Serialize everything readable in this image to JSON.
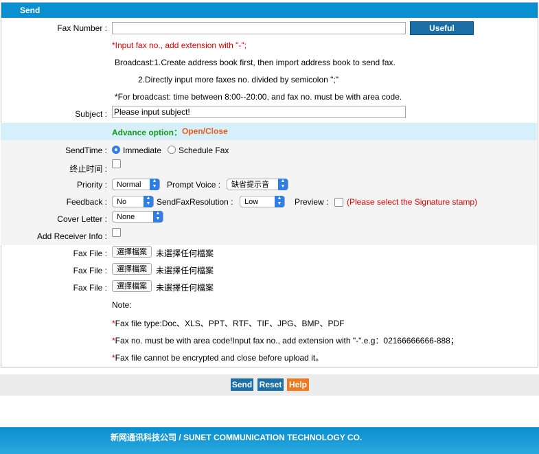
{
  "header": {
    "title": "Send"
  },
  "fax_number": {
    "label": "Fax Number :",
    "value": "",
    "contacts_button": "Useful Contacts"
  },
  "hints": {
    "h1": "*Input fax no., add extension with \"-\";",
    "h2": "Broadcast:1.Create address book first, then import address book to send fax.",
    "h3": "2.Directly input more faxes no. divided by semicolon \";\"",
    "h4": "*For broadcast: time between 8:00--20:00, and fax no. must be with area code."
  },
  "subject": {
    "label": "Subject :",
    "value": "Please input subject!"
  },
  "advance": {
    "label": "Advance option：",
    "toggle": "Open/Close"
  },
  "send_time": {
    "label": "SendTime :",
    "immediate": "Immediate",
    "schedule": "Schedule Fax",
    "selected": "Immediate"
  },
  "end_time": {
    "label": "终止时间 :"
  },
  "priority": {
    "label": "Priority :",
    "value": "Normal"
  },
  "prompt_voice": {
    "label": "Prompt Voice :",
    "value": "缺省提示音"
  },
  "feedback": {
    "label": "Feedback :",
    "value": "No"
  },
  "resolution": {
    "label": "SendFaxResolution :",
    "value": "Low"
  },
  "preview": {
    "label": "Preview :",
    "note": "(Please select the Signature stamp)"
  },
  "cover_letter": {
    "label": "Cover Letter :",
    "value": "None"
  },
  "receiver_info": {
    "label": "Add Receiver Info :"
  },
  "fax_files": [
    {
      "label": "Fax File :",
      "button": "選擇檔案",
      "status": "未選擇任何檔案"
    },
    {
      "label": "Fax File :",
      "button": "選擇檔案",
      "status": "未選擇任何檔案"
    },
    {
      "label": "Fax File :",
      "button": "選擇檔案",
      "status": "未選擇任何檔案"
    }
  ],
  "notes": {
    "title": "Note:",
    "n1": "*Fax file type:Doc、XLS、PPT、RTF、TIF、JPG、BMP、PDF",
    "n2": "*Fax no. must be with area code!Input fax no., add extension with \"-\".e.g：02166666666-888；",
    "n3": "*Fax file cannot be encrypted and close before upload it。"
  },
  "actions": {
    "send": "Send",
    "reset": "Reset",
    "help": "Help"
  },
  "footer": {
    "text": "新网通讯科技公司 / SUNET COMMUNICATION TECHNOLOGY CO."
  },
  "colors": {
    "header": "#0a8fd0",
    "advance_green": "#1a9a1a",
    "toggle_orange": "#f05a1a",
    "note_red": "#e00000",
    "help_orange": "#f07a20",
    "button_blue": "#1a6fa8"
  }
}
